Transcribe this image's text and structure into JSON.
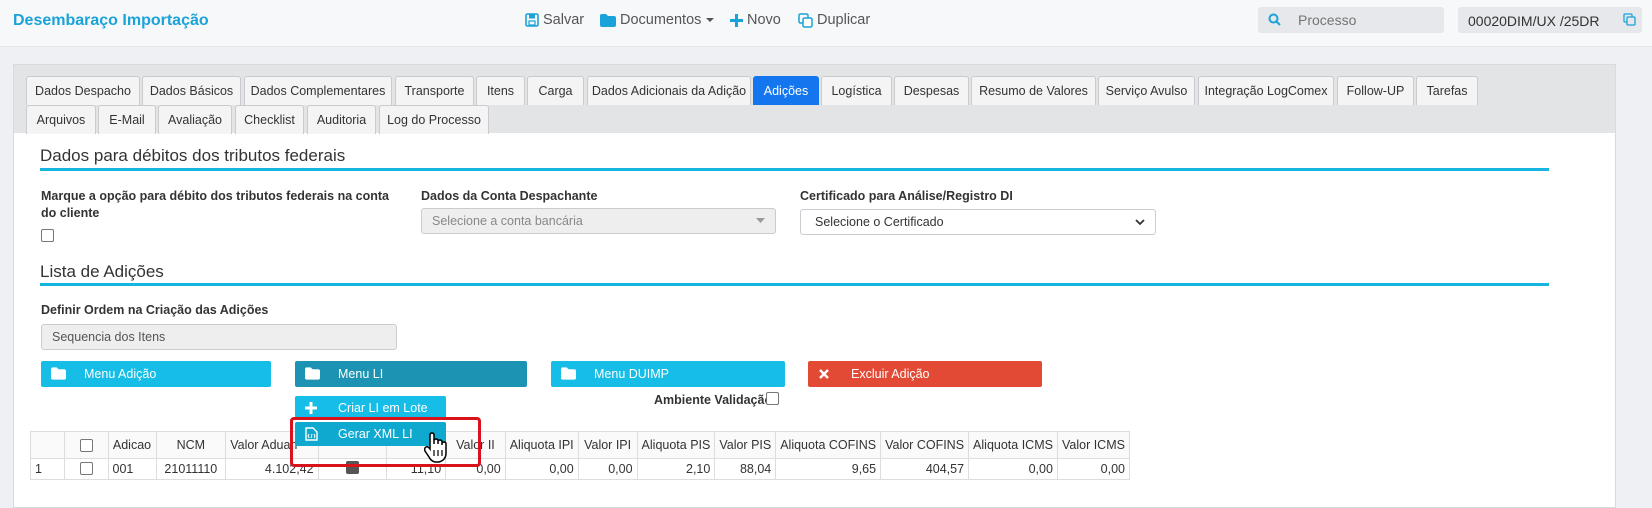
{
  "header": {
    "app_title": "Desembaraço Importação",
    "actions": [
      {
        "label": "Salvar",
        "icon": "save-icon"
      },
      {
        "label": "Documentos",
        "icon": "folder-icon"
      },
      {
        "label": "Novo",
        "icon": "plus-icon"
      },
      {
        "label": "Duplicar",
        "icon": "duplicate-icon"
      }
    ],
    "search_placeholder": "Processo",
    "process_number": "00020DIM/UX /25DR"
  },
  "tabs": {
    "row1": [
      "Dados Despacho",
      "Dados Básicos",
      "Dados Complementares",
      "Transporte",
      "Itens",
      "Carga",
      "Dados Adicionais da Adição",
      "Adições",
      "Logística",
      "Despesas",
      "Resumo de Valores",
      "Serviço Avulso",
      "Integração LogComex",
      "Follow-UP",
      "Tarefas"
    ],
    "row2": [
      "Arquivos",
      "E-Mail",
      "Avaliação",
      "Checklist",
      "Auditoria",
      "Log do Processo"
    ],
    "active": "Adições"
  },
  "tributos": {
    "section_title": "Dados para débitos dos tributos federais",
    "debit_label": "Marque a opção para débito dos tributos federais na conta do cliente",
    "conta_label": "Dados da Conta Despachante",
    "conta_placeholder": "Selecione a conta bancária",
    "cert_label": "Certificado para Análise/Registro DI",
    "cert_value": "Selecione o Certificado"
  },
  "adicoes": {
    "section_title": "Lista de Adições",
    "ordem_label": "Definir Ordem na Criação das Adições",
    "ordem_value": "Sequencia dos Itens",
    "menu_adicao": "Menu Adição",
    "menu_li": "Menu LI",
    "menu_duimp": "Menu DUIMP",
    "excluir": "Excluir Adição",
    "ambiente_label": "Ambiente Validação",
    "dropdown": {
      "criar_li": "Criar LI em Lote",
      "gerar_xml": "Gerar XML LI"
    }
  },
  "colors": {
    "accent": "#1aa3d8",
    "tab_active": "#1476ee",
    "cyan_button": "#16bde6",
    "dark_teal_button": "#1d93b4",
    "danger": "#e34a36",
    "highlight_box": "#d9131b"
  },
  "grid": {
    "headers": [
      "",
      "",
      "Adicao",
      "NCM",
      "Valor Aduan",
      "",
      "",
      "Valor II",
      "Aliquota IPI",
      "Valor IPI",
      "Aliquota PIS",
      "Valor PIS",
      "Aliquota COFINS",
      "Valor COFINS",
      "Aliquota ICMS",
      "Valor ICMS"
    ],
    "rows": [
      {
        "num": "1",
        "adicao": "001",
        "ncm": "21011110",
        "valor_aduan": "4.102,42",
        "col_x": "11,10",
        "valor_ii": "0,00",
        "aliq_ipi": "0,00",
        "valor_ipi": "0,00",
        "aliq_pis": "2,10",
        "valor_pis": "88,04",
        "aliq_cofins": "9,65",
        "valor_cofins": "404,57",
        "aliq_icms": "0,00",
        "valor_icms": "0,00"
      }
    ]
  }
}
